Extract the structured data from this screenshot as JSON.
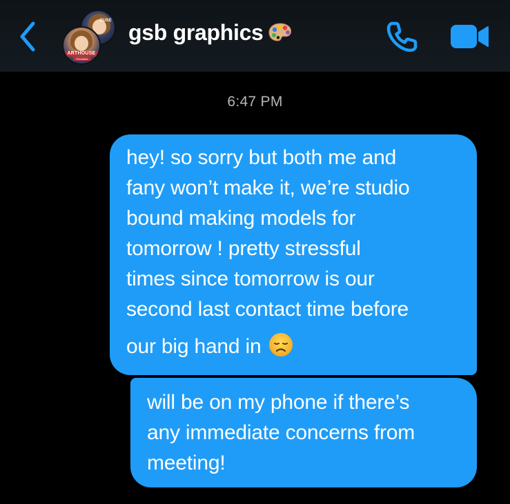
{
  "header": {
    "title": "gsb graphics",
    "title_emoji": "palette-icon",
    "avatars": [
      {
        "label": "ARTHOUSE",
        "sub": "President"
      },
      {
        "label": "OUSE"
      }
    ],
    "accent_color": "#1f9cf7"
  },
  "conversation": {
    "timestamp": "6:47 PM",
    "messages": [
      {
        "sender": "me",
        "lines": [
          "hey! so sorry but both me and",
          "fany won’t make it, we’re studio",
          "bound making models for",
          "tomorrow ! pretty stressful",
          "times since tomorrow is our",
          "second last contact time before",
          "our big hand in"
        ],
        "trailing_emoji": "disappointed-face-icon"
      },
      {
        "sender": "me",
        "lines": [
          "will be on my phone if there’s",
          "any immediate concerns from",
          "meeting!"
        ]
      }
    ],
    "bubble_color": "#1f9cf7"
  }
}
